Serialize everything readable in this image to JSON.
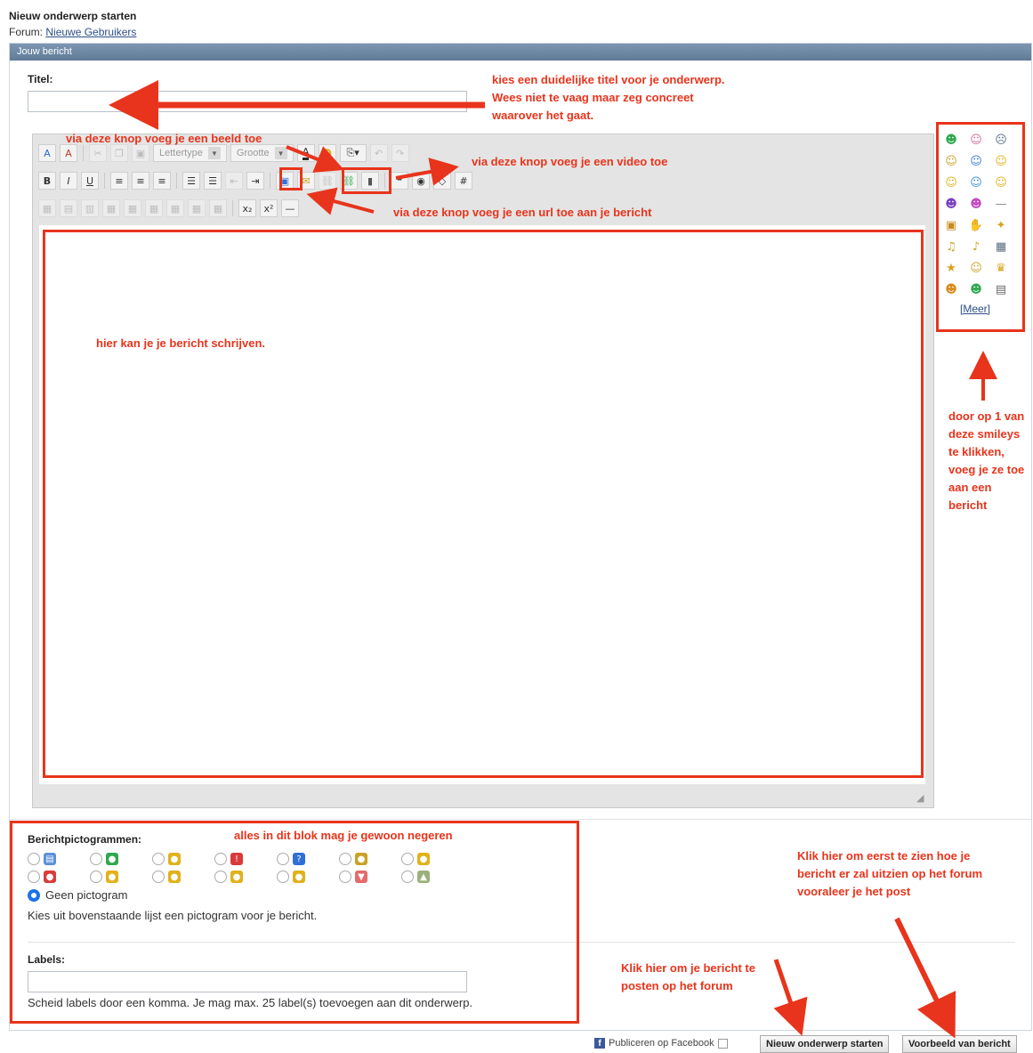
{
  "header": {
    "page_title": "Nieuw onderwerp starten",
    "forum_prefix": "Forum:",
    "forum_link": "Nieuwe Gebruikers",
    "panel_title": "Jouw bericht"
  },
  "title_field": {
    "label": "Titel:",
    "value": ""
  },
  "editor": {
    "font_select": "Lettertype",
    "size_select": "Grootte",
    "row1_buttons": [
      "switch-mode",
      "remove-format",
      "cut",
      "copy",
      "paste",
      "font-color",
      "highlight",
      "attachment",
      "undo",
      "redo"
    ],
    "row2_buttons": [
      "bold",
      "italic",
      "underline",
      "align-left",
      "align-center",
      "align-right",
      "ordered-list",
      "unordered-list",
      "outdent",
      "indent",
      "insert-image",
      "insert-email",
      "insert-link",
      "insert-video",
      "insert-media",
      "insert-quote",
      "unlink",
      "insert-php",
      "insert-code"
    ],
    "format_labels": {
      "bold": "B",
      "italic": "I",
      "underline": "U",
      "subscript": "x₂",
      "superscript": "x²"
    },
    "content": ""
  },
  "smileys": {
    "items": [
      {
        "name": "smile-green",
        "glyph": "☻",
        "color": "#2fa84f"
      },
      {
        "name": "tongue",
        "glyph": "☺",
        "color": "#d46a9a"
      },
      {
        "name": "cry",
        "glyph": "☹",
        "color": "#5a6b80"
      },
      {
        "name": "cool",
        "glyph": "☺",
        "color": "#c9a227"
      },
      {
        "name": "blush",
        "glyph": "☺",
        "color": "#3a7bd5"
      },
      {
        "name": "grin",
        "glyph": "☺",
        "color": "#e0b21b"
      },
      {
        "name": "wink",
        "glyph": "☺",
        "color": "#e0b21b"
      },
      {
        "name": "confused",
        "glyph": "☺",
        "color": "#3b8fd6"
      },
      {
        "name": "happy",
        "glyph": "☺",
        "color": "#e0b21b"
      },
      {
        "name": "evil",
        "glyph": "☻",
        "color": "#7a3fbf"
      },
      {
        "name": "devil",
        "glyph": "☻",
        "color": "#c34abf"
      },
      {
        "name": "zipped",
        "glyph": "—",
        "color": "#8a8a8a"
      },
      {
        "name": "book",
        "glyph": "▣",
        "color": "#c98a1b"
      },
      {
        "name": "thumb",
        "glyph": "✋",
        "color": "#e0b21b"
      },
      {
        "name": "game",
        "glyph": "✦",
        "color": "#d9a21b"
      },
      {
        "name": "music",
        "glyph": "♫",
        "color": "#c9a227"
      },
      {
        "name": "notes",
        "glyph": "♪",
        "color": "#c9a227"
      },
      {
        "name": "calendar",
        "glyph": "▦",
        "color": "#5a6b80"
      },
      {
        "name": "star",
        "glyph": "★",
        "color": "#d9a21b"
      },
      {
        "name": "kiss",
        "glyph": "☺",
        "color": "#c9a227"
      },
      {
        "name": "trophy",
        "glyph": "♛",
        "color": "#d9a21b"
      },
      {
        "name": "pumpkin",
        "glyph": "☻",
        "color": "#d98a1b"
      },
      {
        "name": "alien",
        "glyph": "☻",
        "color": "#2fa84f"
      },
      {
        "name": "scroll",
        "glyph": "▤",
        "color": "#6b6b6b"
      }
    ],
    "more_label": "[Meer]"
  },
  "pictograms": {
    "label": "Berichtpictogrammen:",
    "row1": [
      {
        "name": "document",
        "color": "#5b8fd9",
        "glyph": "▤"
      },
      {
        "name": "speech-green",
        "color": "#2fa84f",
        "glyph": "●"
      },
      {
        "name": "lightbulb",
        "color": "#e0b21b",
        "glyph": "●"
      },
      {
        "name": "exclamation-red",
        "color": "#d93b3b",
        "glyph": "!"
      },
      {
        "name": "question-blue",
        "color": "#2f6fd6",
        "glyph": "?"
      },
      {
        "name": "cool-smiley",
        "color": "#c9a227",
        "glyph": "●"
      },
      {
        "name": "smiley-yellow",
        "color": "#e0b21b",
        "glyph": "●"
      }
    ],
    "row2": [
      {
        "name": "angry-red",
        "color": "#d93b3b",
        "glyph": "●"
      },
      {
        "name": "smiley-happy",
        "color": "#e0b21b",
        "glyph": "●"
      },
      {
        "name": "smiley-wink",
        "color": "#e0b21b",
        "glyph": "●"
      },
      {
        "name": "smiley-grin",
        "color": "#e0b21b",
        "glyph": "●"
      },
      {
        "name": "smiley-sad",
        "color": "#e0b21b",
        "glyph": "●"
      },
      {
        "name": "thumbs-down",
        "color": "#e56a6a",
        "glyph": "▼"
      },
      {
        "name": "thumbs-up",
        "color": "#9bb07a",
        "glyph": "▲"
      }
    ],
    "none_option": "Geen pictogram",
    "help": "Kies uit bovenstaande lijst een pictogram voor je bericht."
  },
  "labels_field": {
    "label": "Labels:",
    "value": "",
    "help": "Scheid labels door een komma. Je mag max. 25 label(s) toevoegen aan dit onderwerp."
  },
  "footer": {
    "facebook_label": "Publiceren op Facebook",
    "submit_button": "Nieuw onderwerp starten",
    "preview_button": "Voorbeeld van bericht"
  },
  "annotations": {
    "title_note": "kies een duidelijke titel voor je onderwerp. Wees niet te vaag maar zeg concreet waarover het gaat.",
    "image_note": "via deze knop voeg je een beeld toe",
    "video_note": "via deze knop voeg je een video toe",
    "url_note": "via deze knop voeg je een url toe aan je bericht",
    "editor_note": "hier kan je je bericht schrijven.",
    "smiley_note": "door op 1 van deze smileys te klikken, voeg je ze toe aan een bericht",
    "block_note": "alles in dit blok mag je gewoon negeren",
    "preview_note": "Klik hier om eerst te zien hoe je bericht er zal uitzien op het forum vooraleer je het post",
    "post_note": "Klik hier om je bericht te posten op het forum",
    "accent_color": "#e8341c"
  }
}
